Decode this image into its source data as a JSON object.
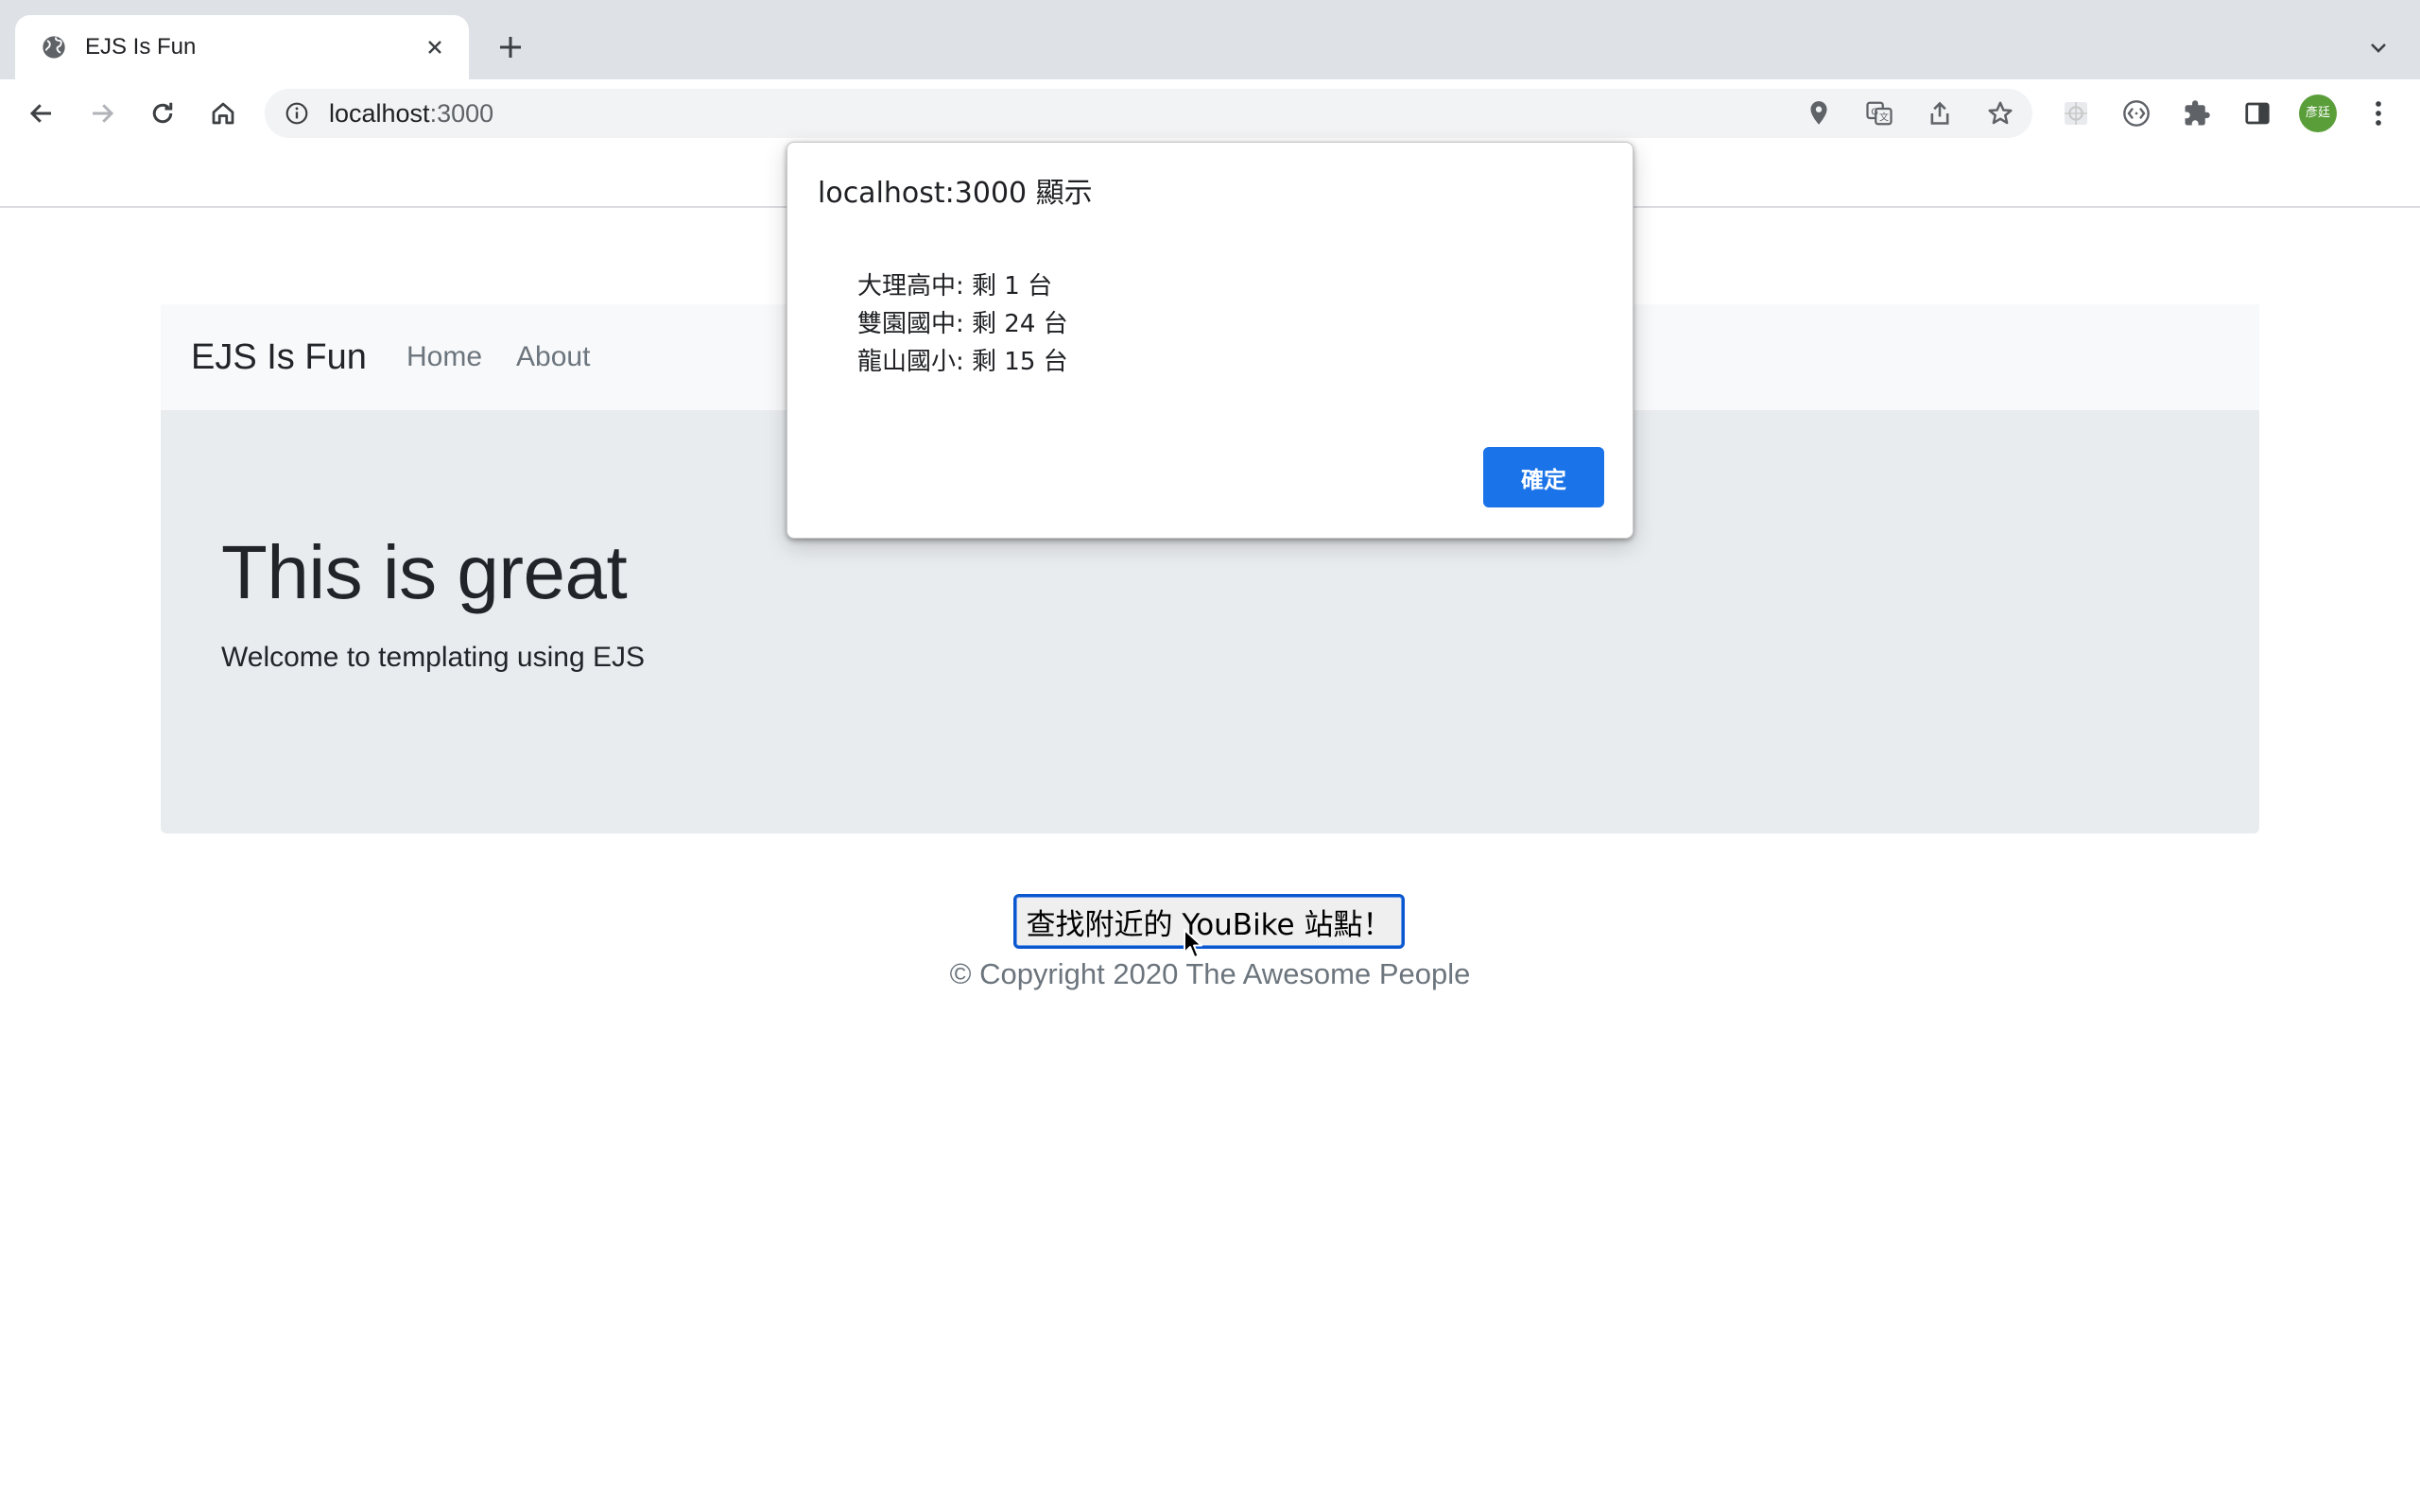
{
  "browser": {
    "tab": {
      "title": "EJS Is Fun",
      "favicon": "globe-icon"
    },
    "address": {
      "host": "localhost",
      "port": ":3000"
    },
    "profile_initials": "彥廷",
    "accent": "#1a73e8",
    "profile_color": "#5a9e3a"
  },
  "navbar": {
    "brand": "EJS Is Fun",
    "links": [
      "Home",
      "About"
    ]
  },
  "jumbotron": {
    "title": "This is great",
    "lead": "Welcome to templating using EJS"
  },
  "find_button": "查找附近的 YouBike 站點！",
  "footer": "© Copyright 2020 The Awesome People",
  "dialog": {
    "title": "localhost:3000 顯示",
    "lines": [
      "大理高中: 剩 1 台",
      "雙園國中: 剩 24 台",
      "龍山國小: 剩 15 台"
    ],
    "ok_label": "確定"
  }
}
